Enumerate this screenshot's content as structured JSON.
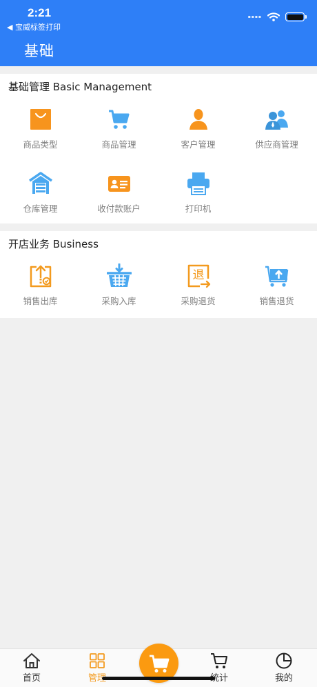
{
  "status_bar": {
    "time": "2:21",
    "back_app": "◀ 宝威标签打印",
    "signal": "▪▪▪▪"
  },
  "header": {
    "title": "基础"
  },
  "basic": {
    "title": "基础管理 Basic Management",
    "items": [
      {
        "label": "商品类型",
        "icon": "shopping-bag-icon"
      },
      {
        "label": "商品管理",
        "icon": "shopping-cart-icon"
      },
      {
        "label": "客户管理",
        "icon": "person-icon"
      },
      {
        "label": "供应商管理",
        "icon": "group-icon"
      },
      {
        "label": "仓库管理",
        "icon": "warehouse-icon"
      },
      {
        "label": "收付款账户",
        "icon": "id-card-icon"
      },
      {
        "label": "打印机",
        "icon": "printer-icon"
      }
    ]
  },
  "business": {
    "title": "开店业务 Business",
    "items": [
      {
        "label": "销售出库",
        "icon": "sales-outbound-icon"
      },
      {
        "label": "采购入库",
        "icon": "purchase-inbound-icon"
      },
      {
        "label": "采购退货",
        "icon": "purchase-return-icon"
      },
      {
        "label": "销售退货",
        "icon": "sales-return-icon"
      }
    ]
  },
  "tabbar": {
    "tabs": [
      {
        "label": "首页",
        "icon": "home-icon"
      },
      {
        "label": "管理",
        "icon": "grid-icon",
        "active": true
      },
      {
        "label": "统计",
        "icon": "cart-outline-icon"
      },
      {
        "label": "我的",
        "icon": "pie-chart-icon"
      }
    ],
    "center_icon": "cart-icon"
  },
  "colors": {
    "primary": "#2e7ff7",
    "orange": "#f39a1e",
    "blue_icon": "#4aa8f0",
    "text_gray": "#808080"
  }
}
